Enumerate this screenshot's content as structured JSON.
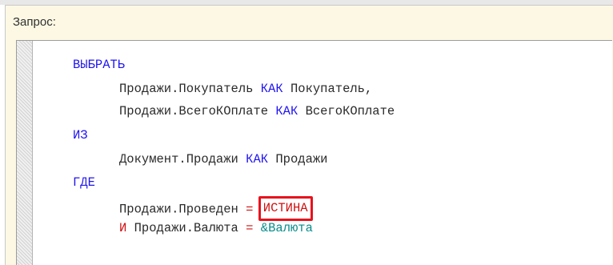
{
  "panel": {
    "label": "Запрос:"
  },
  "query": {
    "select_kw": "ВЫБРАТЬ",
    "field1_expr": "Продажи.Покупатель",
    "field1_as_kw": "КАК",
    "field1_alias": "Покупатель,",
    "field2_expr": "Продажи.ВсегоКОплате",
    "field2_as_kw": "КАК",
    "field2_alias": "ВсегоКОплате",
    "from_kw": "ИЗ",
    "source_expr": "Документ.Продажи",
    "source_as_kw": "КАК",
    "source_alias": "Продажи",
    "where_kw": "ГДЕ",
    "cond1_expr": "Продажи.Проведен",
    "cond1_op": "=",
    "cond1_value": "ИСТИНА",
    "cond2_and_kw": "И",
    "cond2_expr": "Продажи.Валюта",
    "cond2_op": "=",
    "cond2_param": "&Валюта"
  },
  "colors": {
    "keyword": "#1f14f0",
    "text": "#2a2a2a",
    "operator": "#d01010",
    "parameter": "#0a8c8c",
    "highlight_box": "#e8121c",
    "panel_background": "#fcf8e4"
  }
}
